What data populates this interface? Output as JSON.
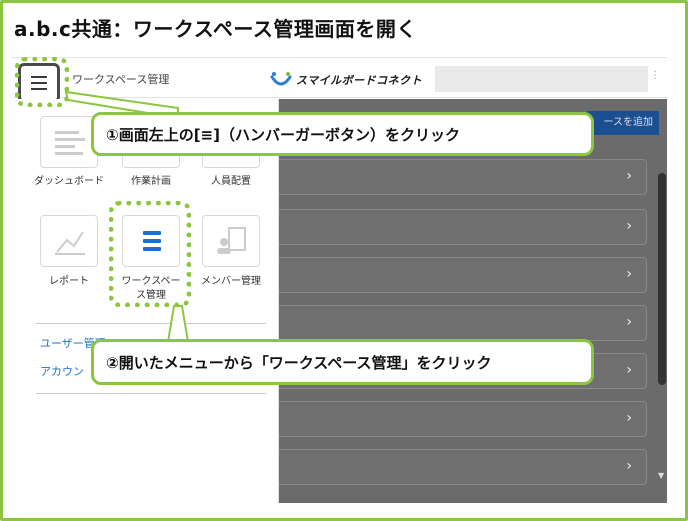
{
  "heading": "a.b.c共通：ワークスペース管理画面を開く",
  "topbar": {
    "app_title": "ワークスペース管理",
    "brand": "スマイルボードコネクト",
    "menu_icon": "hamburger-icon"
  },
  "sidemenu": {
    "tiles": [
      {
        "label": "ダッシュボード",
        "icon": "dashboard-icon"
      },
      {
        "label": "作業計画",
        "icon": "work-plan-icon"
      },
      {
        "label": "人員配置",
        "icon": "staffing-icon"
      },
      {
        "label": "レポート",
        "icon": "report-icon"
      },
      {
        "label": "ワークスペース管理",
        "icon": "workspace-list-icon"
      },
      {
        "label": "メンバー管理",
        "icon": "member-icon"
      }
    ],
    "links": [
      "ユーザー管理",
      "アカウン"
    ]
  },
  "main": {
    "top_action": "ースを追加",
    "chevron": "›"
  },
  "callouts": {
    "step1": "①画面左上の[≡]（ハンバーガーボタン）をクリック",
    "step2": "②開いたメニューから「ワークスペース管理」をクリック"
  },
  "colors": {
    "accent_green": "#8cc63f",
    "link_blue": "#1a73c9",
    "primary_blue": "#1b4f8f",
    "overlay_gray": "#6b6b6b"
  }
}
